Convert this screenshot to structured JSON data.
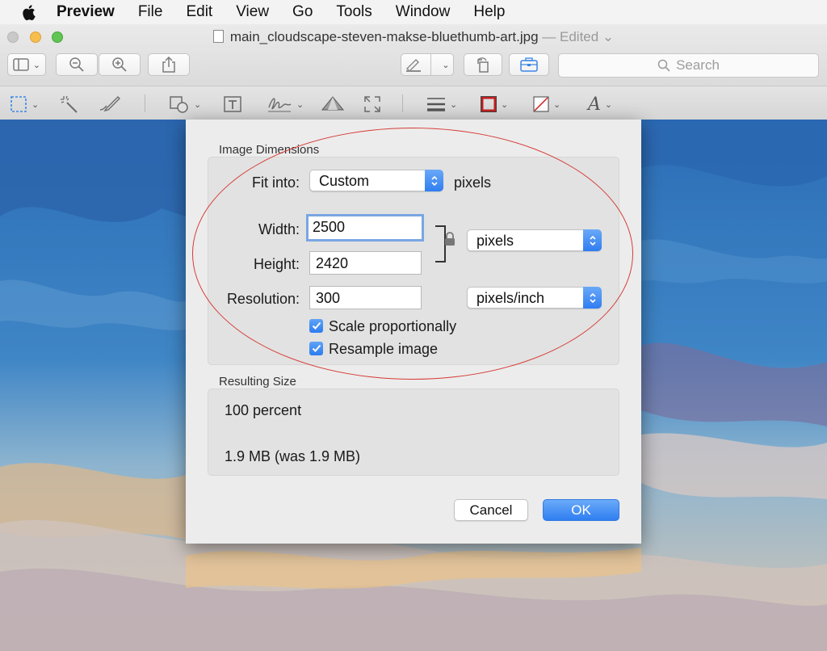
{
  "menubar": {
    "items": [
      "Preview",
      "File",
      "Edit",
      "View",
      "Go",
      "Tools",
      "Window",
      "Help"
    ]
  },
  "window": {
    "filename": "main_cloudscape-steven-makse-bluethumb-art.jpg",
    "edited_label": " — Edited ⌄"
  },
  "toolbar": {
    "search_placeholder": "Search"
  },
  "dialog": {
    "image_dimensions_label": "Image Dimensions",
    "fit_into_label": "Fit into:",
    "fit_into_value": "Custom",
    "fit_into_unit": "pixels",
    "width_label": "Width:",
    "width_value": "2500",
    "height_label": "Height:",
    "height_value": "2420",
    "size_unit": "pixels",
    "resolution_label": "Resolution:",
    "resolution_value": "300",
    "resolution_unit": "pixels/inch",
    "scale_label": "Scale proportionally",
    "scale_checked": true,
    "resample_label": "Resample image",
    "resample_checked": true,
    "resulting_size_label": "Resulting Size",
    "percent_text": "100 percent",
    "size_text": "1.9 MB (was 1.9 MB)",
    "cancel_label": "Cancel",
    "ok_label": "OK"
  },
  "colors": {
    "accent": "#2f7df1",
    "annotation": "#d63a35"
  }
}
